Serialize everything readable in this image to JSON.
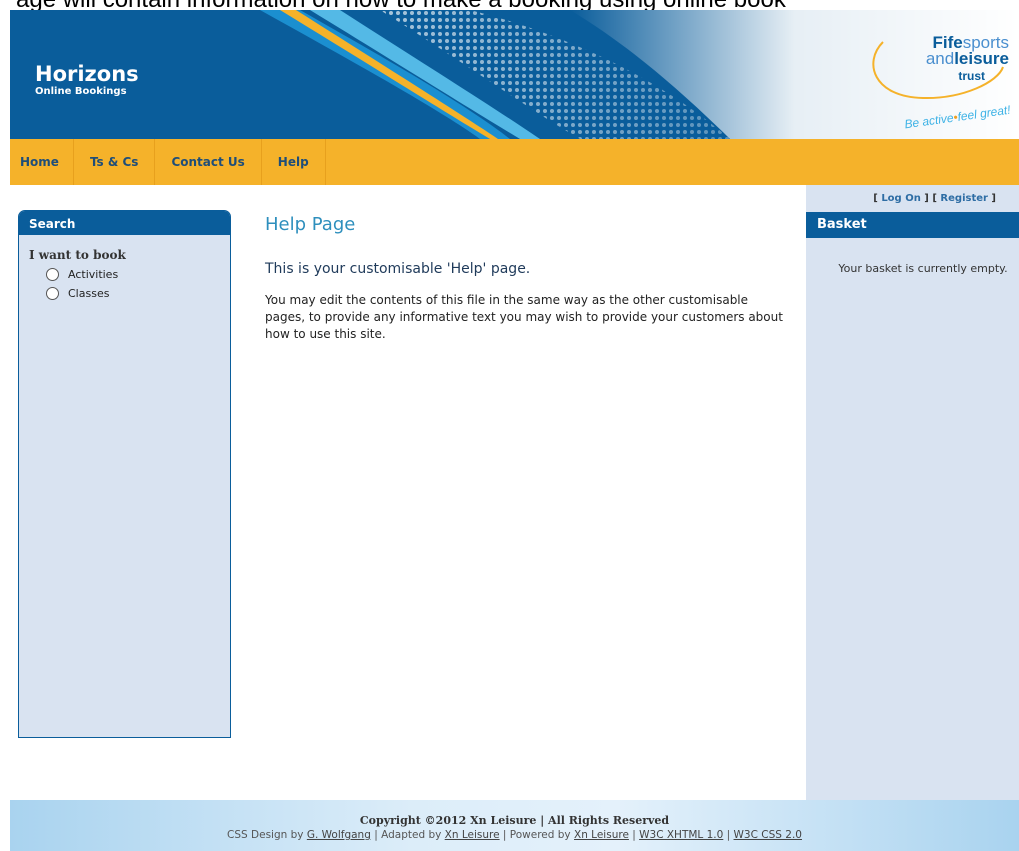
{
  "top_banner_text": "age will contain information on how to make a booking using online book",
  "header": {
    "title": "Horizons",
    "subtitle": "Online Bookings",
    "brand": {
      "line1_bold": "Fife",
      "line1_light": "sports",
      "line2_light": "and",
      "line2_bold": "leisure",
      "line3": "trust",
      "tagline_active": "Be active",
      "tagline_sep": "•",
      "tagline_feel": "feel great!"
    }
  },
  "nav": {
    "items": [
      {
        "label": "Home"
      },
      {
        "label": "Ts & Cs"
      },
      {
        "label": "Contact Us"
      },
      {
        "label": "Help"
      }
    ]
  },
  "search": {
    "title": "Search",
    "label": "I want to book",
    "options": [
      {
        "label": "Activities",
        "checked": false
      },
      {
        "label": "Classes",
        "checked": false
      }
    ]
  },
  "main": {
    "title": "Help Page",
    "subtitle": "This is your customisable 'Help' page.",
    "body": "You may edit the contents of this file in the same way as the other customisable pages, to provide any informative text you may wish to provide your customers about how to use this site."
  },
  "auth": {
    "open1": "[ ",
    "log_on": "Log On",
    "mid": " ] [ ",
    "register": "Register",
    "close": " ]"
  },
  "basket": {
    "title": "Basket",
    "empty_text": "Your basket is currently empty."
  },
  "footer": {
    "copyright": "Copyright ©2012 Xn Leisure | All Rights Reserved",
    "css_by_prefix": "CSS Design by ",
    "css_by_link": "G. Wolfgang",
    "adapted_prefix": " | Adapted by ",
    "adapted_link": "Xn Leisure",
    "powered_prefix": " | Powered by ",
    "powered_link": "Xn Leisure",
    "sep": " | ",
    "xhtml_link": "W3C XHTML 1.0",
    "css_link": "W3C CSS 2.0"
  },
  "colors": {
    "header_blue": "#0a5d9b",
    "nav_orange": "#f5b22a",
    "panel_bg": "#d9e3f1",
    "title_teal": "#2e8fbd"
  }
}
